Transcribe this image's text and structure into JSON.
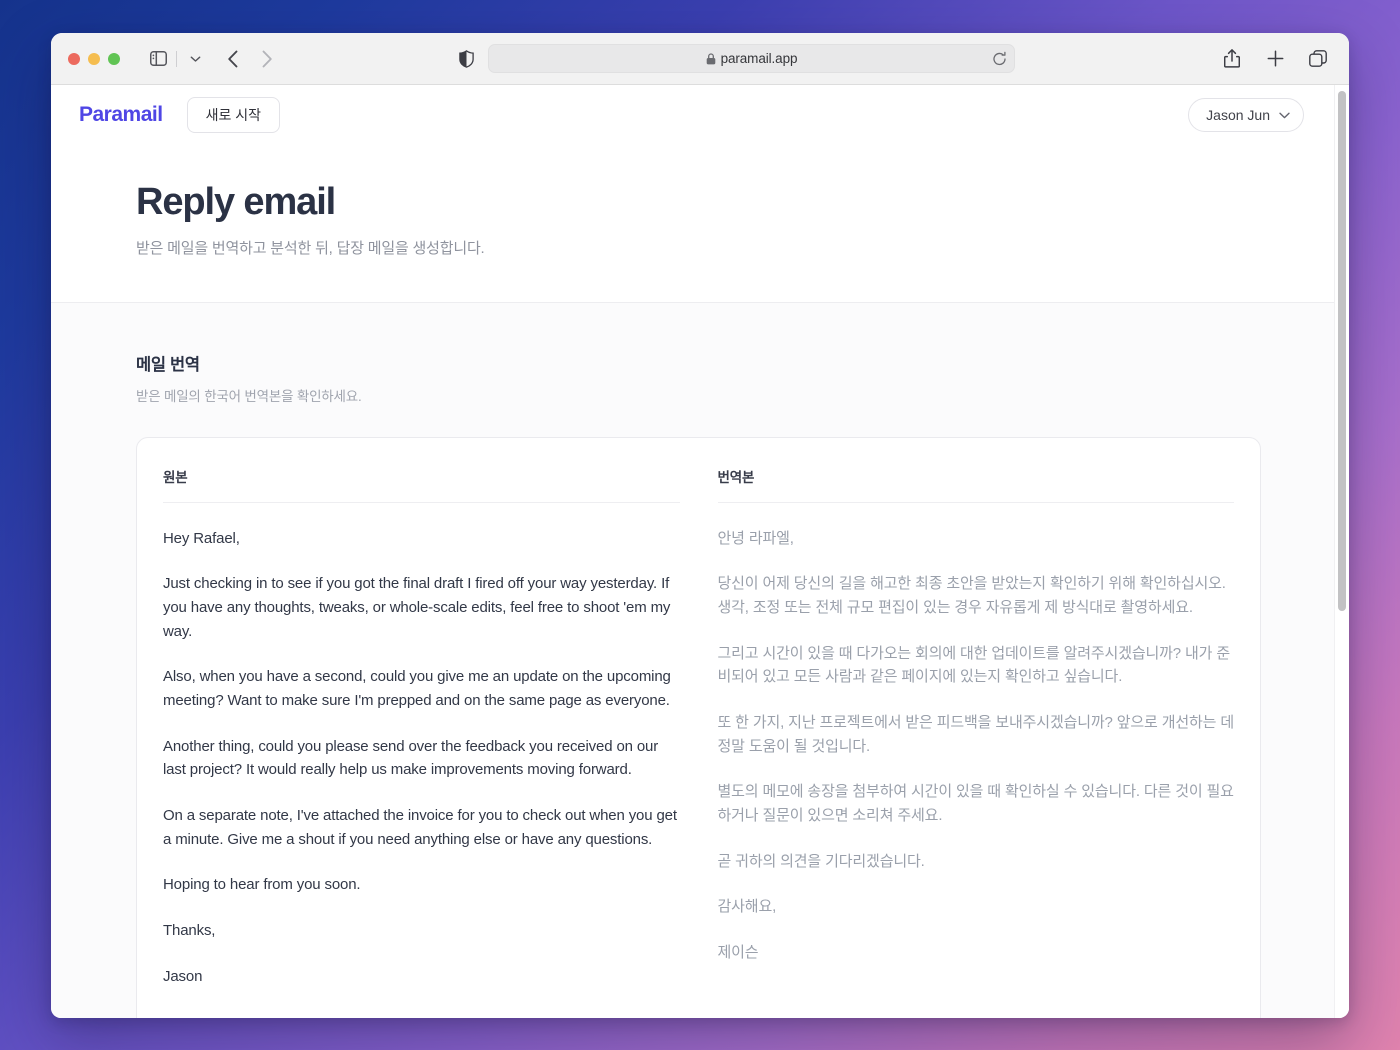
{
  "browser": {
    "url": "paramail.app",
    "icons": {
      "sidebar": "sidebar-icon",
      "sidebar_dropdown": "chevron-down-icon",
      "back": "back-arrow-icon",
      "forward": "forward-arrow-icon",
      "shield": "privacy-shield-icon",
      "lock": "lock-icon",
      "reload": "reload-icon",
      "share": "share-icon",
      "new_tab": "plus-icon",
      "tab_overview": "tab-overview-icon"
    },
    "traffic_lights": [
      "close-button",
      "minimize-button",
      "maximize-button"
    ]
  },
  "app": {
    "brand": "Paramail",
    "new_button": "새로 시작",
    "user": "Jason Jun"
  },
  "header": {
    "title": "Reply email",
    "subtitle": "받은 메일을 번역하고 분석한 뒤, 답장 메일을 생성합니다."
  },
  "section": {
    "title": "메일 번역",
    "description": "받은 메일의 한국어 번역본을 확인하세요."
  },
  "card": {
    "source": {
      "label": "원본",
      "paragraphs": [
        "Hey Rafael,",
        "Just checking in to see if you got the final draft I fired off your way yesterday. If you have any thoughts, tweaks, or whole-scale edits, feel free to shoot 'em my way.",
        "Also, when you have a second, could you give me an update on the upcoming meeting? Want to make sure I'm prepped and on the same page as everyone.",
        "Another thing, could you please send over the feedback you received on our last project? It would really help us make improvements moving forward.",
        "On a separate note, I've attached the invoice for you to check out when you get a minute. Give me a shout if you need anything else or have any questions.",
        "Hoping to hear from you soon.",
        "Thanks,",
        "Jason"
      ]
    },
    "translation": {
      "label": "번역본",
      "paragraphs": [
        "안녕 라파엘,",
        "당신이 어제 당신의 길을 해고한 최종 초안을 받았는지 확인하기 위해 확인하십시오. 생각, 조정 또는 전체 규모 편집이 있는 경우 자유롭게 제 방식대로 촬영하세요.",
        "그리고 시간이 있을 때 다가오는 회의에 대한 업데이트를 알려주시겠습니까? 내가 준비되어 있고 모든 사람과 같은 페이지에 있는지 확인하고 싶습니다.",
        "또 한 가지, 지난 프로젝트에서 받은 피드백을 보내주시겠습니까? 앞으로 개선하는 데 정말 도움이 될 것입니다.",
        "별도의 메모에 송장을 첨부하여 시간이 있을 때 확인하실 수 있습니다. 다른 것이 필요하거나 질문이 있으면 소리쳐 주세요.",
        "곧 귀하의 의견을 기다리겠습니다.",
        "감사해요,",
        "제이슨"
      ]
    }
  },
  "colors": {
    "brand": "#4f46e5",
    "title": "#2b3245",
    "muted": "#9aa0ab",
    "desktop_start": "#15338c",
    "desktop_end": "#e083ae"
  }
}
